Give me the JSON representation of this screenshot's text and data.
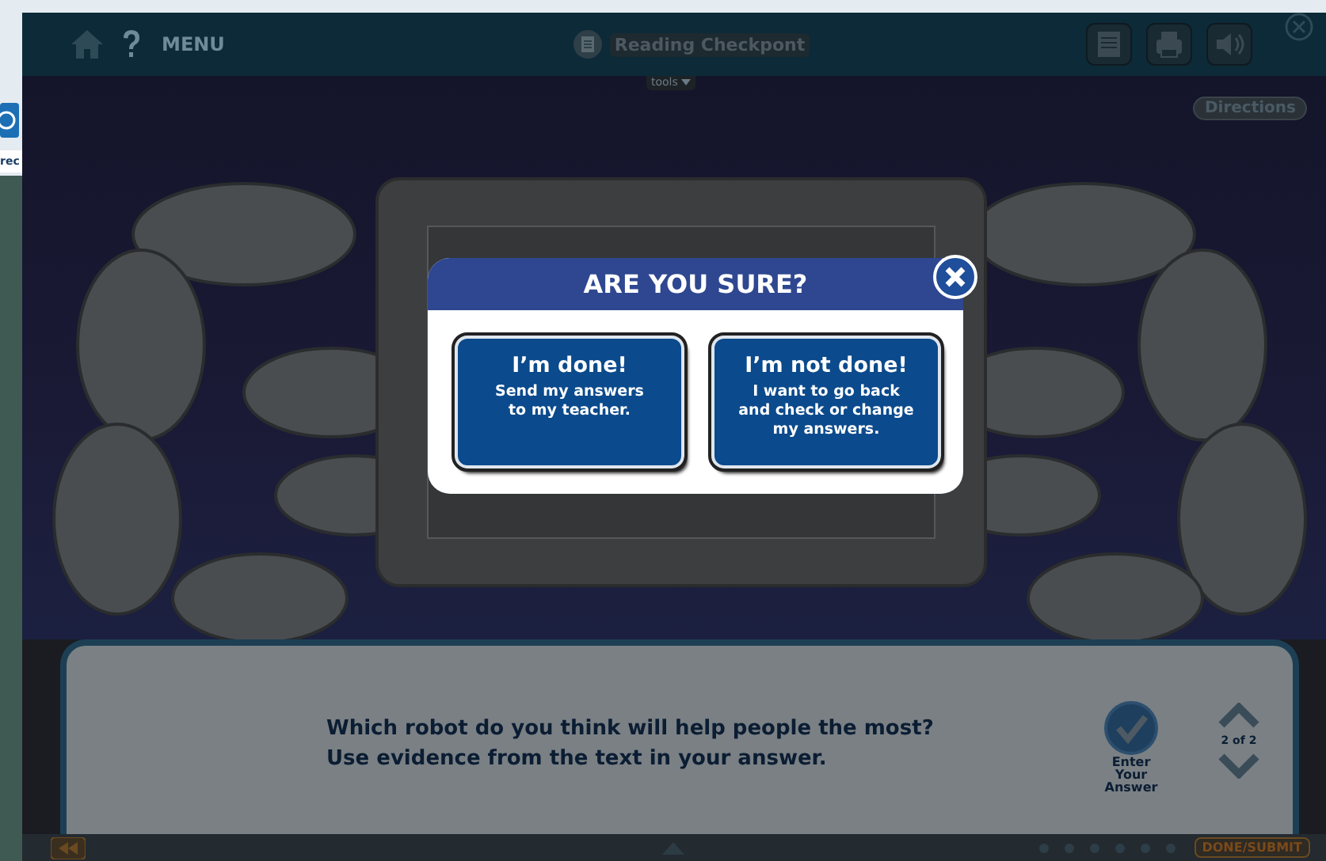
{
  "left_strip": {
    "label": "rec"
  },
  "top_bar": {
    "menu": "MENU",
    "title": "Reading Checkpont",
    "tools": "tools"
  },
  "directions": "Directions",
  "modal": {
    "title": "ARE YOU SURE?",
    "options": [
      {
        "heading": "I’m done!",
        "text": "Send my answers\nto my teacher."
      },
      {
        "heading": "I’m not done!",
        "text": "I want to go back\nand check or change\nmy answers."
      }
    ]
  },
  "question": {
    "text": "Which robot do you think will help people the most?\nUse evidence from the text in your answer.",
    "enter": "Enter\nYour\nAnswer",
    "pager": "2 of 2"
  },
  "footer": {
    "submit": "DONE/SUBMIT"
  }
}
